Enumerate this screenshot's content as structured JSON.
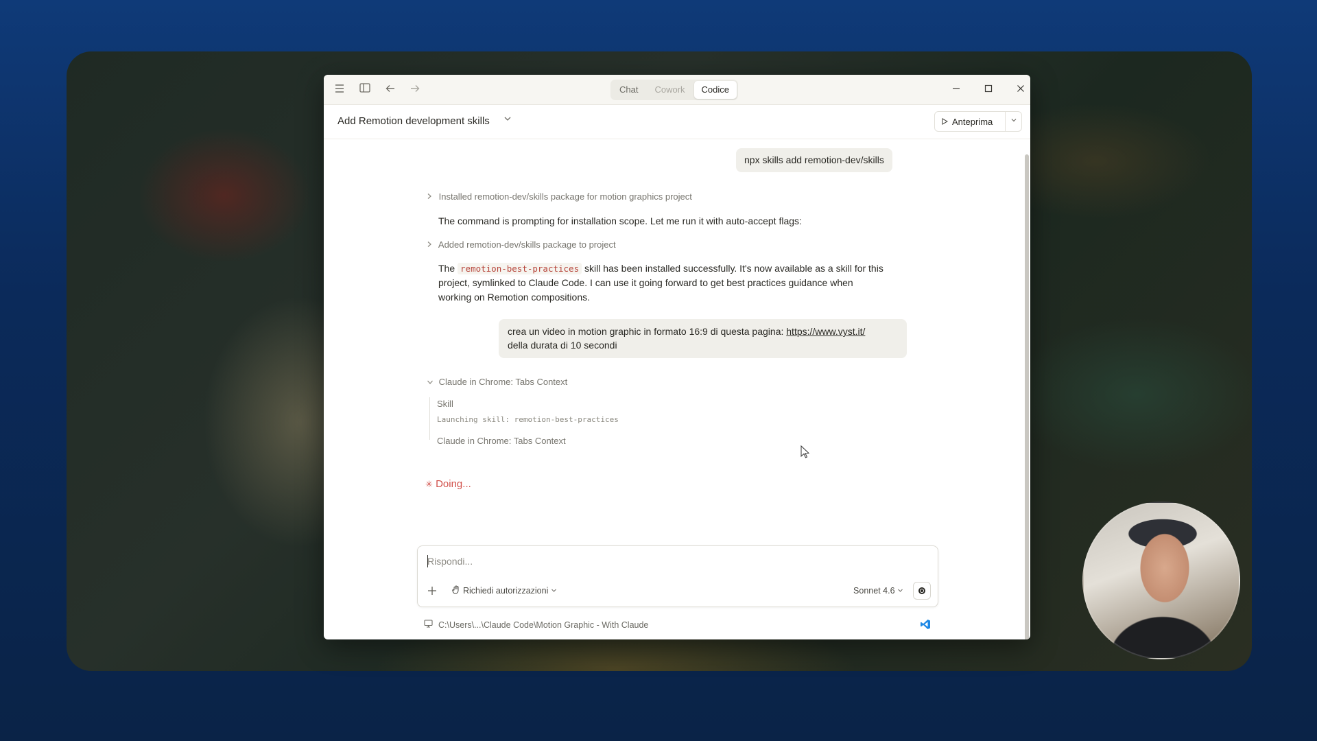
{
  "titlebar": {
    "tabs": [
      {
        "label": "Chat",
        "state": "normal"
      },
      {
        "label": "Cowork",
        "state": "disabled"
      },
      {
        "label": "Codice",
        "state": "active"
      }
    ],
    "icons": [
      "menu-icon",
      "sidebar-toggle-icon",
      "back-arrow-icon",
      "forward-arrow-icon"
    ],
    "window_controls": [
      "minimize-icon",
      "maximize-icon",
      "close-icon"
    ]
  },
  "header": {
    "conversation_title": "Add Remotion development skills",
    "preview_label": "Anteprima"
  },
  "messages": {
    "user_1": "npx skills add remotion-dev/skills",
    "tool_1": "Installed remotion-dev/skills package for motion graphics project",
    "assistant_1": "The command is prompting for installation scope. Let me run it with auto-accept flags:",
    "tool_2": "Added remotion-dev/skills package to project",
    "assistant_2_pre": "The",
    "assistant_2_code": "remotion-best-practices",
    "assistant_2_line1": "skill has been installed successfully. It's now available as a skill for this",
    "assistant_2_line2": "project, symlinked to Claude Code. I can use it going forward to get best practices guidance when",
    "assistant_2_line3": "working on Remotion compositions.",
    "user_2_text": "crea un video in motion graphic in formato 16:9 di questa pagina:",
    "user_2_link": "https://www.vyst.it/",
    "user_2_line2": "della durata di 10 secondi",
    "tool_group_title": "Claude in Chrome: Tabs Context",
    "tool_group_skill": "Skill",
    "tool_group_skill_detail": "Launching skill: remotion-best-practices",
    "tool_group_last": "Claude in Chrome: Tabs Context",
    "status": "Doing..."
  },
  "composer": {
    "placeholder": "Rispondi...",
    "permission_label": "Richiedi autorizzazioni",
    "model_label": "Sonnet 4.6"
  },
  "footer": {
    "path": "C:\\Users\\...\\Claude Code\\Motion Graphic - With Claude"
  },
  "colors": {
    "accent_status": "#d1504a",
    "inline_code": "#b6443a",
    "vscode_blue": "#1e88e5"
  }
}
